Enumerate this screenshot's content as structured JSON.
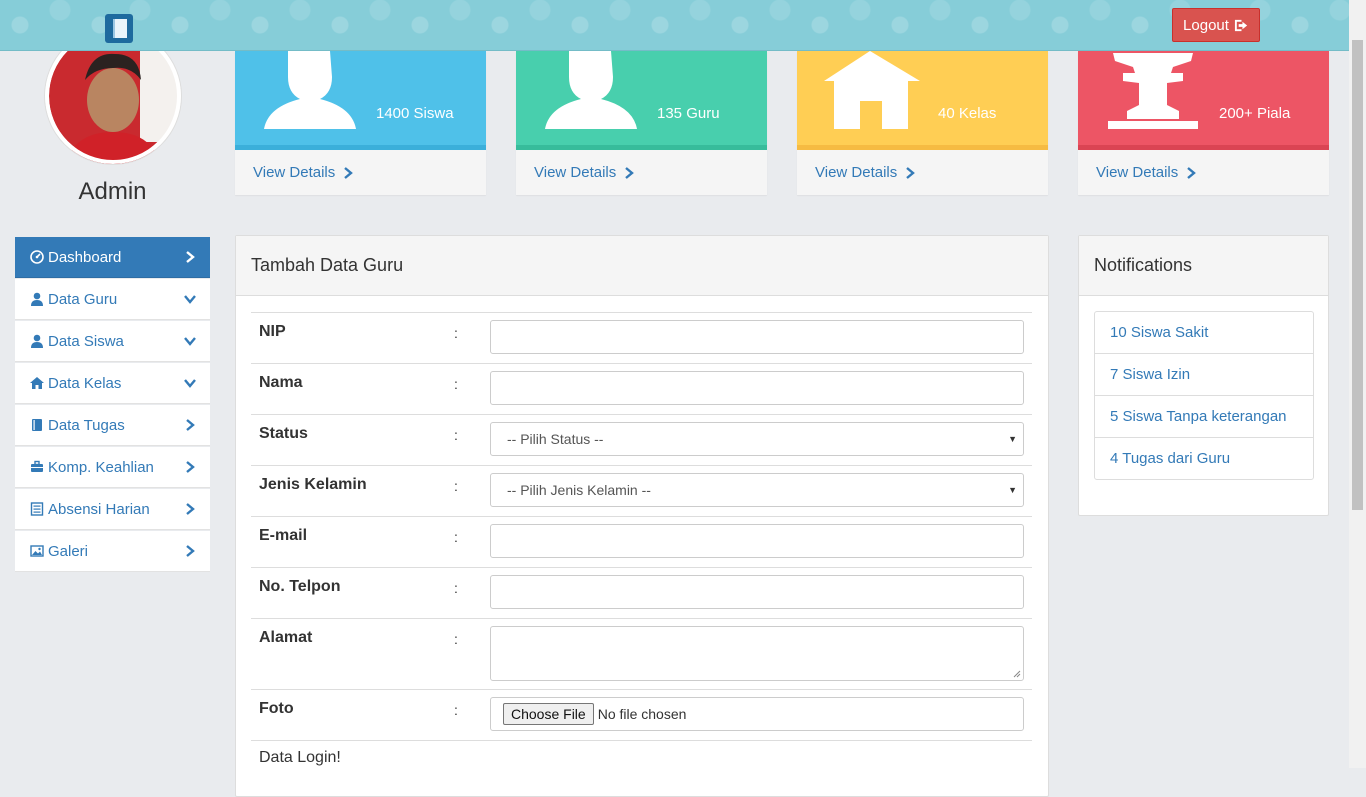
{
  "header": {
    "logout_label": "Logout"
  },
  "profile": {
    "name": "Admin"
  },
  "sidebar": {
    "items": [
      {
        "label": "Dashboard",
        "icon": "dashboard-icon",
        "chevron": "right",
        "active": true
      },
      {
        "label": "Data Guru",
        "icon": "user-icon",
        "chevron": "down"
      },
      {
        "label": "Data Siswa",
        "icon": "user-icon",
        "chevron": "down"
      },
      {
        "label": "Data Kelas",
        "icon": "home-icon",
        "chevron": "down"
      },
      {
        "label": "Data Tugas",
        "icon": "book-icon",
        "chevron": "right"
      },
      {
        "label": "Komp. Keahlian",
        "icon": "briefcase-icon",
        "chevron": "right"
      },
      {
        "label": "Absensi Harian",
        "icon": "list-icon",
        "chevron": "right"
      },
      {
        "label": "Galeri",
        "icon": "picture-icon",
        "chevron": "right"
      }
    ]
  },
  "stats": [
    {
      "count": "1400 Siswa",
      "link": "View Details",
      "color": "#4fc1e9",
      "accent": "#3bafda",
      "icon": "user-icon"
    },
    {
      "count": "135 Guru",
      "link": "View Details",
      "color": "#48cfad",
      "accent": "#37bc9b",
      "icon": "user-icon"
    },
    {
      "count": "40 Kelas",
      "link": "View Details",
      "color": "#ffce54",
      "accent": "#f6bb42",
      "icon": "home-icon"
    },
    {
      "count": "200+ Piala",
      "link": "View Details",
      "color": "#ed5565",
      "accent": "#da4453",
      "icon": "trophy-icon"
    }
  ],
  "form": {
    "title": "Tambah Data Guru",
    "colon": ":",
    "fields": [
      {
        "label": "NIP",
        "type": "text"
      },
      {
        "label": "Nama",
        "type": "text"
      },
      {
        "label": "Status",
        "type": "select",
        "value": "-- Pilih Status --"
      },
      {
        "label": "Jenis Kelamin",
        "type": "select",
        "value": "-- Pilih Jenis Kelamin --"
      },
      {
        "label": "E-mail",
        "type": "text"
      },
      {
        "label": "No. Telpon",
        "type": "text"
      },
      {
        "label": "Alamat",
        "type": "textarea"
      },
      {
        "label": "Foto",
        "type": "file",
        "button": "Choose File",
        "status": "No file chosen"
      }
    ],
    "section_label": "Data Login!"
  },
  "notifications": {
    "title": "Notifications",
    "items": [
      "10 Siswa Sakit",
      "7 Siswa Izin",
      "5 Siswa Tanpa keterangan",
      "4 Tugas dari Guru"
    ]
  }
}
